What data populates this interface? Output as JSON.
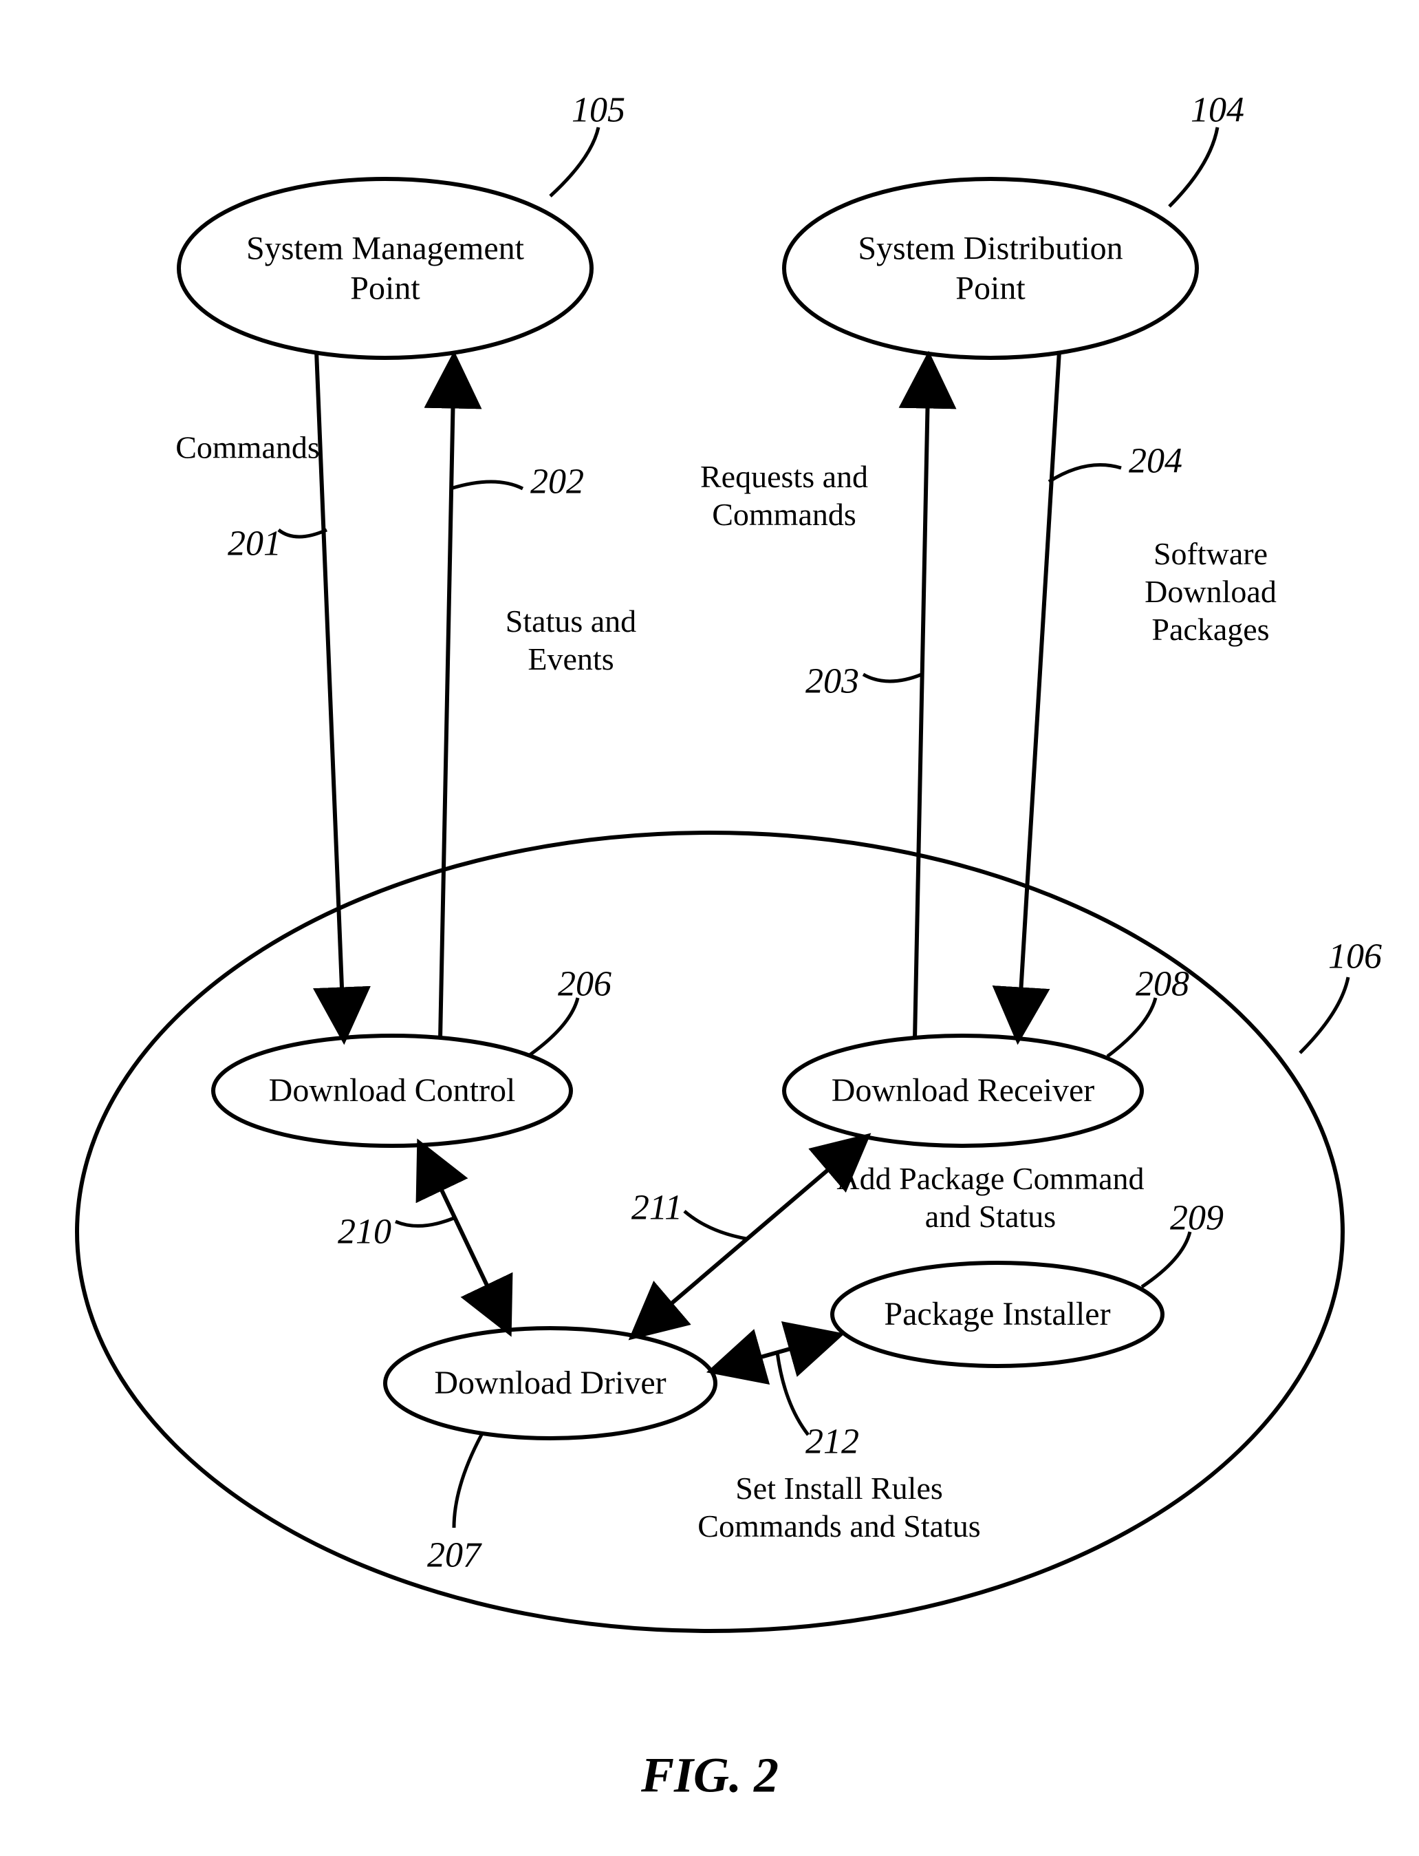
{
  "figure_title": "FIG. 2",
  "nodes": {
    "sys_mgmt": "System Management\nPoint",
    "sys_dist": "System Distribution\nPoint",
    "dl_control": "Download Control",
    "dl_receiver": "Download Receiver",
    "dl_driver": "Download Driver",
    "pkg_installer": "Package Installer"
  },
  "edges": {
    "commands": "Commands",
    "status_events": "Status and\nEvents",
    "req_cmds": "Requests and\nCommands",
    "sw_pkgs": "Software\nDownload\nPackages",
    "add_pkg": "Add Package Command\nand Status",
    "set_rules": "Set Install Rules\nCommands and Status"
  },
  "refs": {
    "r104": "104",
    "r105": "105",
    "r106": "106",
    "r201": "201",
    "r202": "202",
    "r203": "203",
    "r204": "204",
    "r206": "206",
    "r207": "207",
    "r208": "208",
    "r209": "209",
    "r210": "210",
    "r211": "211",
    "r212": "212"
  }
}
